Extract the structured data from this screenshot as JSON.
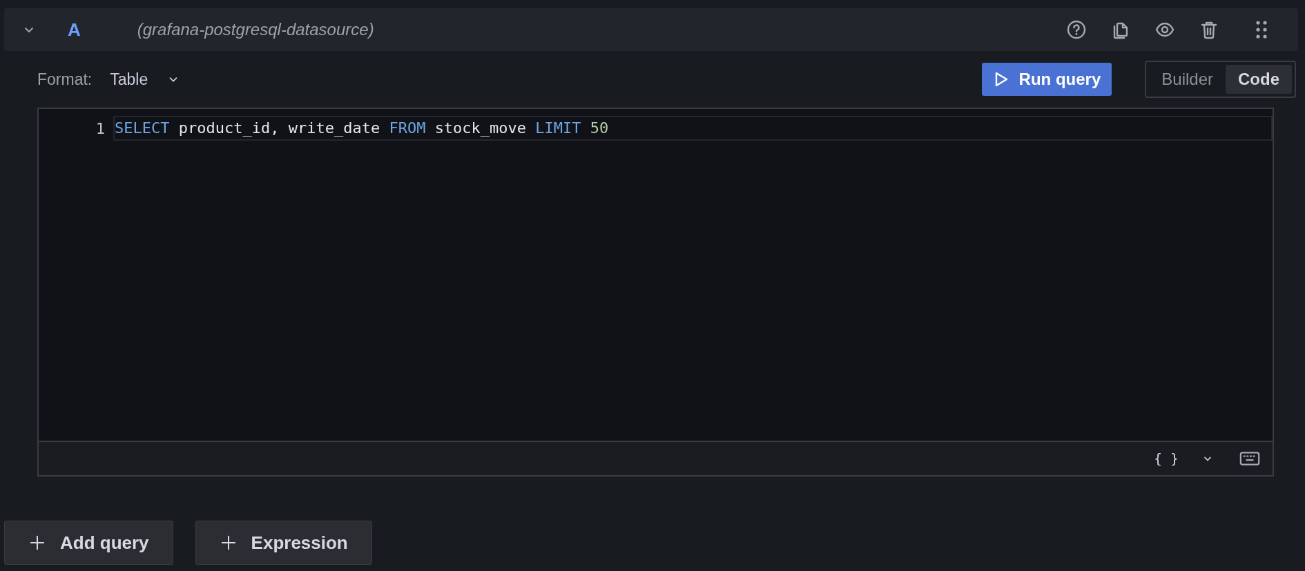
{
  "query": {
    "expanded": true,
    "ref_id": "A",
    "datasource": "(grafana-postgresql-datasource)"
  },
  "format": {
    "label": "Format:",
    "value": "Table"
  },
  "run_button": "Run query",
  "mode_tabs": [
    {
      "label": "Builder",
      "selected": false
    },
    {
      "label": "Code",
      "selected": true
    }
  ],
  "editor": {
    "lines": [
      {
        "number": "1",
        "tokens": [
          {
            "text": "SELECT",
            "kind": "keyword"
          },
          {
            "text": "product_id, write_date",
            "kind": "plain"
          },
          {
            "text": "FROM",
            "kind": "keyword"
          },
          {
            "text": "stock_move",
            "kind": "plain"
          },
          {
            "text": "LIMIT",
            "kind": "keyword"
          },
          {
            "text": "50",
            "kind": "number"
          }
        ]
      }
    ],
    "format_button": "{ }"
  },
  "actions": [
    "Add query",
    "Expression"
  ]
}
